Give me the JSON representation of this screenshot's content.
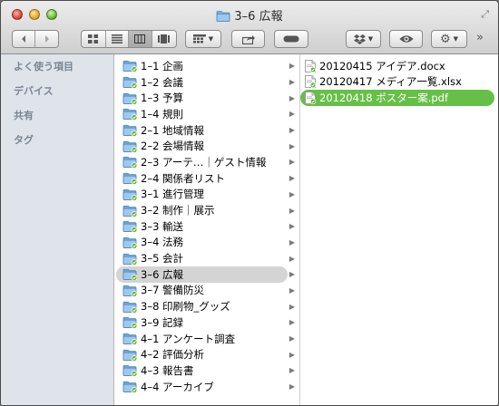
{
  "window": {
    "title": "3–6 広報"
  },
  "toolbar": {
    "back_icon": "chevron-left-icon",
    "forward_icon": "chevron-right-icon",
    "view_icons": [
      "icon-view-icon",
      "list-view-icon",
      "column-view-icon",
      "coverflow-view-icon"
    ],
    "arrange_icon": "grid-arrange-icon",
    "share_icon": "share-icon",
    "tag_icon": "tag-pill-icon",
    "dropbox_icon": "dropbox-icon",
    "quicklook_icon": "eye-icon",
    "action_icon": "gear-icon",
    "overflow_label": "»"
  },
  "sidebar": {
    "items": [
      {
        "label": "よく使う項目"
      },
      {
        "label": "デバイス"
      },
      {
        "label": "共有"
      },
      {
        "label": "タグ"
      }
    ]
  },
  "folders": [
    {
      "label": "1–1 企画"
    },
    {
      "label": "1–2 会議"
    },
    {
      "label": "1–3 予算"
    },
    {
      "label": "1–4 規則"
    },
    {
      "label": "2–1 地域情報"
    },
    {
      "label": "2–2 会場情報"
    },
    {
      "label": "2–3 アーテ…｜ゲスト情報"
    },
    {
      "label": "2–4 関係者リスト"
    },
    {
      "label": "3–1 進行管理"
    },
    {
      "label": "3–2 制作｜展示"
    },
    {
      "label": "3–3 輸送"
    },
    {
      "label": "3–4 法務"
    },
    {
      "label": "3–5 会計"
    },
    {
      "label": "3–6 広報",
      "selected": true
    },
    {
      "label": "3–7 警備防災"
    },
    {
      "label": "3–8 印刷物_グッズ"
    },
    {
      "label": "3–9 記録"
    },
    {
      "label": "4–1 アンケート調査"
    },
    {
      "label": "4–2 評価分析"
    },
    {
      "label": "4–3 報告書"
    },
    {
      "label": "4–4 アーカイブ"
    }
  ],
  "files": [
    {
      "label": "20120415 アイデア.docx"
    },
    {
      "label": "20120417 メディア一覧.xlsx"
    },
    {
      "label": "20120418 ポスター案.pdf",
      "selected": true
    }
  ],
  "colors": {
    "selection_green": "#66c047",
    "selection_gray": "#d4d4d4",
    "folder_blue": "#7fb2e0",
    "sync_check_green": "#5cb531"
  }
}
